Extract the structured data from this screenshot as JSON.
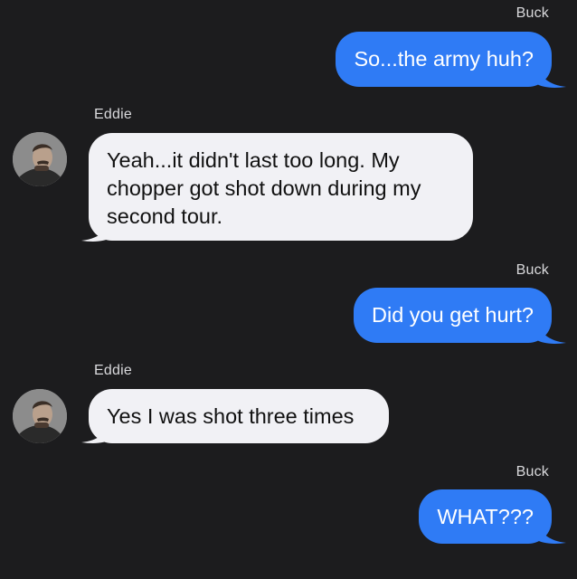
{
  "colors": {
    "background": "#1c1c1e",
    "outgoing_bubble": "#2f7bf5",
    "incoming_bubble": "#f1f1f5",
    "sender_label": "#d9d9dc"
  },
  "messages": [
    {
      "direction": "outgoing",
      "sender": "Buck",
      "text": "So...the army huh?"
    },
    {
      "direction": "incoming",
      "sender": "Eddie",
      "text": "Yeah...it didn't last too long. My chopper got shot down during my second tour.",
      "avatar_icon": "eddie-avatar"
    },
    {
      "direction": "outgoing",
      "sender": "Buck",
      "text": "Did you get hurt?"
    },
    {
      "direction": "incoming",
      "sender": "Eddie",
      "text": "Yes I was shot three times",
      "avatar_icon": "eddie-avatar"
    },
    {
      "direction": "outgoing",
      "sender": "Buck",
      "text": "WHAT???"
    }
  ]
}
